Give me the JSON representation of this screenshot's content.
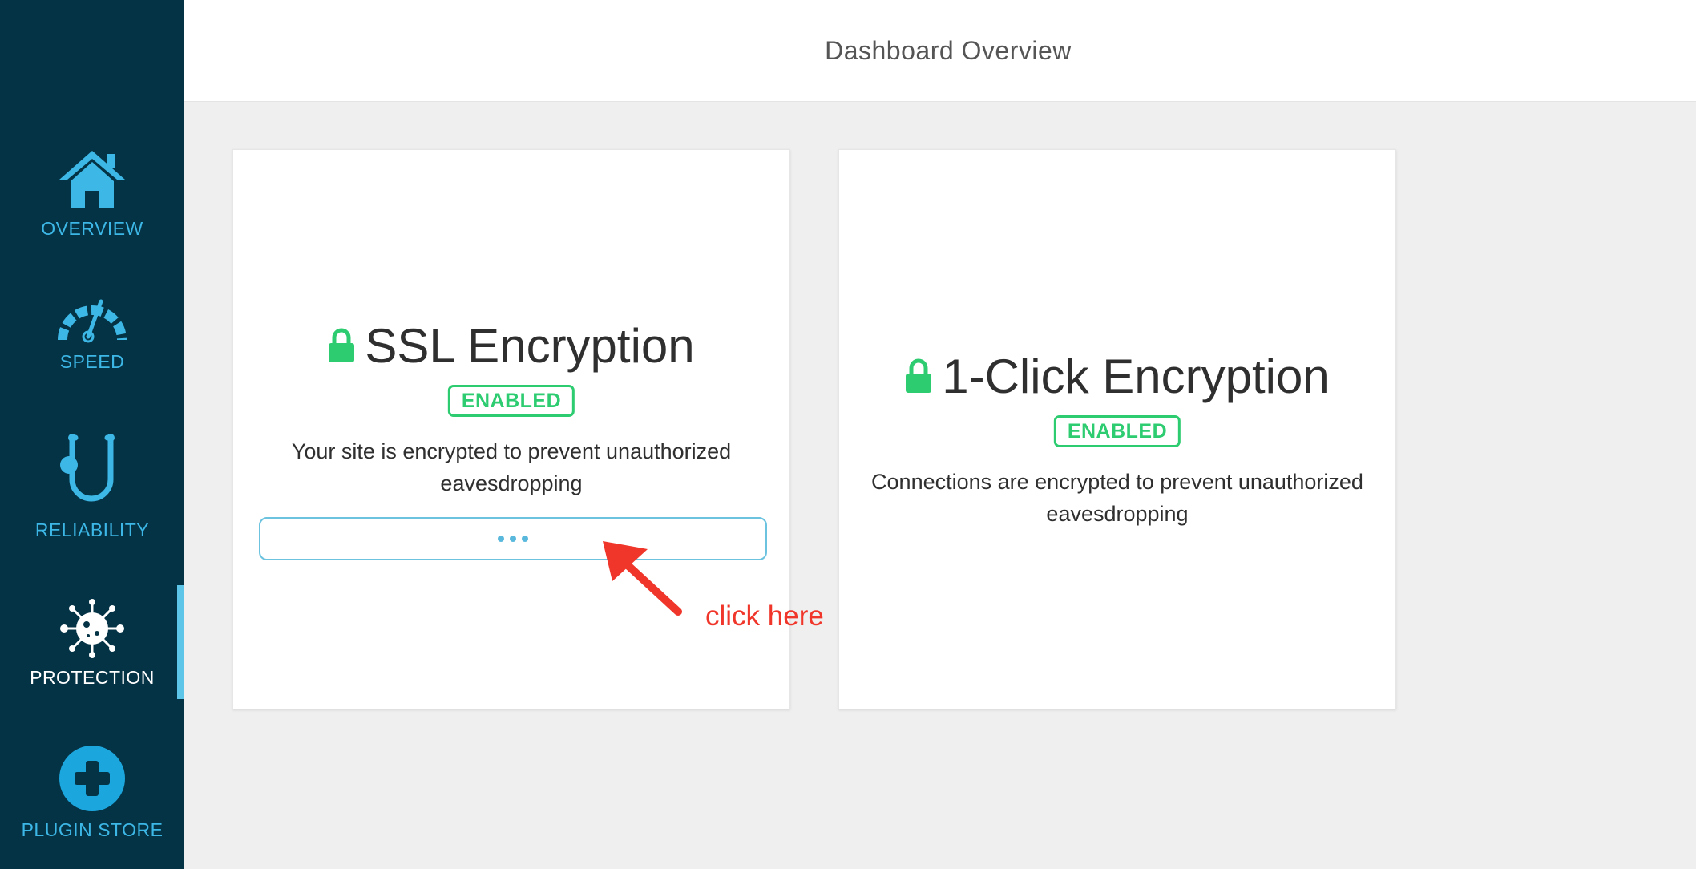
{
  "header": {
    "title": "Dashboard Overview"
  },
  "sidebar": {
    "items": [
      {
        "label": "OVERVIEW",
        "icon": "home-icon"
      },
      {
        "label": "SPEED",
        "icon": "speedometer-icon"
      },
      {
        "label": "RELIABILITY",
        "icon": "stethoscope-icon"
      },
      {
        "label": "PROTECTION",
        "icon": "virus-icon",
        "active": true
      },
      {
        "label": "PLUGIN STORE",
        "icon": "plus-circle-icon"
      }
    ]
  },
  "cards": [
    {
      "title": "SSL Encryption",
      "status": "ENABLED",
      "description": "Your site is encrypted to prevent unauthorized eavesdropping",
      "button_state": "loading"
    },
    {
      "title": "1-Click Encryption",
      "status": "ENABLED",
      "description": "Connections are encrypted to prevent unauthorized eavesdropping"
    }
  ],
  "annotation": {
    "text": "click here"
  },
  "colors": {
    "sidebar_bg": "#053346",
    "accent_blue": "#3cb7e6",
    "enabled_green": "#2ecc71",
    "annotation_red": "#f0362a"
  }
}
